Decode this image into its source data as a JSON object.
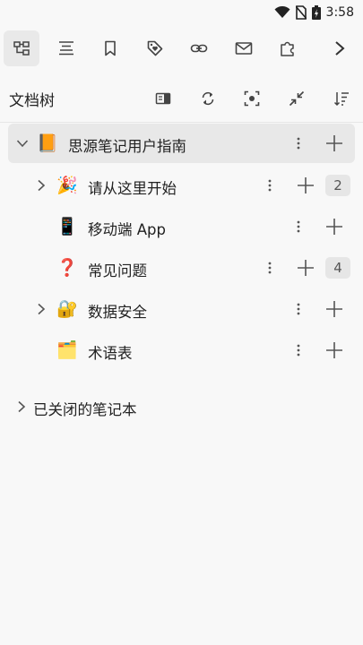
{
  "status_bar": {
    "time": "3:58"
  },
  "toolbar": {
    "buttons": [
      {
        "icon": "file-tree-icon",
        "active": true
      },
      {
        "icon": "outline-icon"
      },
      {
        "icon": "bookmark-icon"
      },
      {
        "icon": "tag-icon"
      },
      {
        "icon": "link-icon"
      },
      {
        "icon": "inbox-icon"
      },
      {
        "icon": "plugin-icon"
      }
    ],
    "more_icon": "chevron-right-icon"
  },
  "section": {
    "title": "文档树",
    "actions": [
      "focus-sidebar-icon",
      "refresh-icon",
      "locate-icon",
      "collapse-icon",
      "sort-icon"
    ]
  },
  "tree": {
    "notebook": {
      "label": "思源笔记用户指南",
      "emoji": "📙",
      "expanded": true
    },
    "docs": [
      {
        "label": "请从这里开始",
        "emoji": "🎉",
        "has_children": true,
        "count": "2"
      },
      {
        "label": "移动端 App",
        "emoji": "📱",
        "has_children": false,
        "count": ""
      },
      {
        "label": "常见问题",
        "emoji": "❓",
        "has_children": false,
        "count": "4"
      },
      {
        "label": "数据安全",
        "emoji": "🔐",
        "has_children": true,
        "count": ""
      },
      {
        "label": "术语表",
        "emoji": "🗂️",
        "has_children": false,
        "count": ""
      }
    ]
  },
  "closed_notebooks": {
    "label": "已关闭的笔记本"
  },
  "colors": {
    "selected_bg": "#e8e8e8",
    "badge_bg": "#e6e6e6",
    "icon": "#444444"
  }
}
